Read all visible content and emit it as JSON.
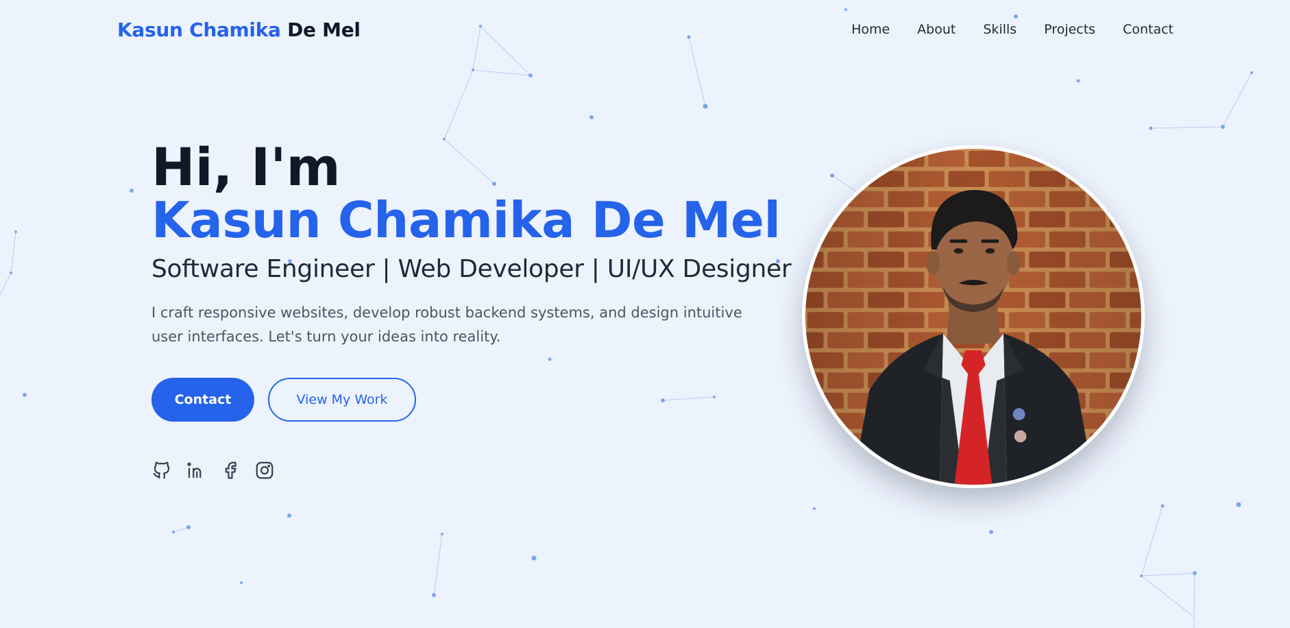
{
  "nav": {
    "brand_first": "Kasun Chamika",
    "brand_last": "De Mel",
    "links": [
      "Home",
      "About",
      "Skills",
      "Projects",
      "Contact"
    ]
  },
  "hero": {
    "greeting": "Hi, I'm",
    "name": "Kasun Chamika De Mel",
    "roles": "Software Engineer | Web Developer | UI/UX Designer",
    "description": "I craft responsive websites, develop robust backend systems, and design intuitive user interfaces. Let's turn your ideas into reality.",
    "primary_button": "Contact",
    "secondary_button": "View My Work"
  },
  "socials": [
    "github-icon",
    "linkedin-icon",
    "facebook-icon",
    "instagram-icon"
  ],
  "colors": {
    "accent": "#2563eb",
    "background": "#edf3fd",
    "text": "#111827"
  }
}
